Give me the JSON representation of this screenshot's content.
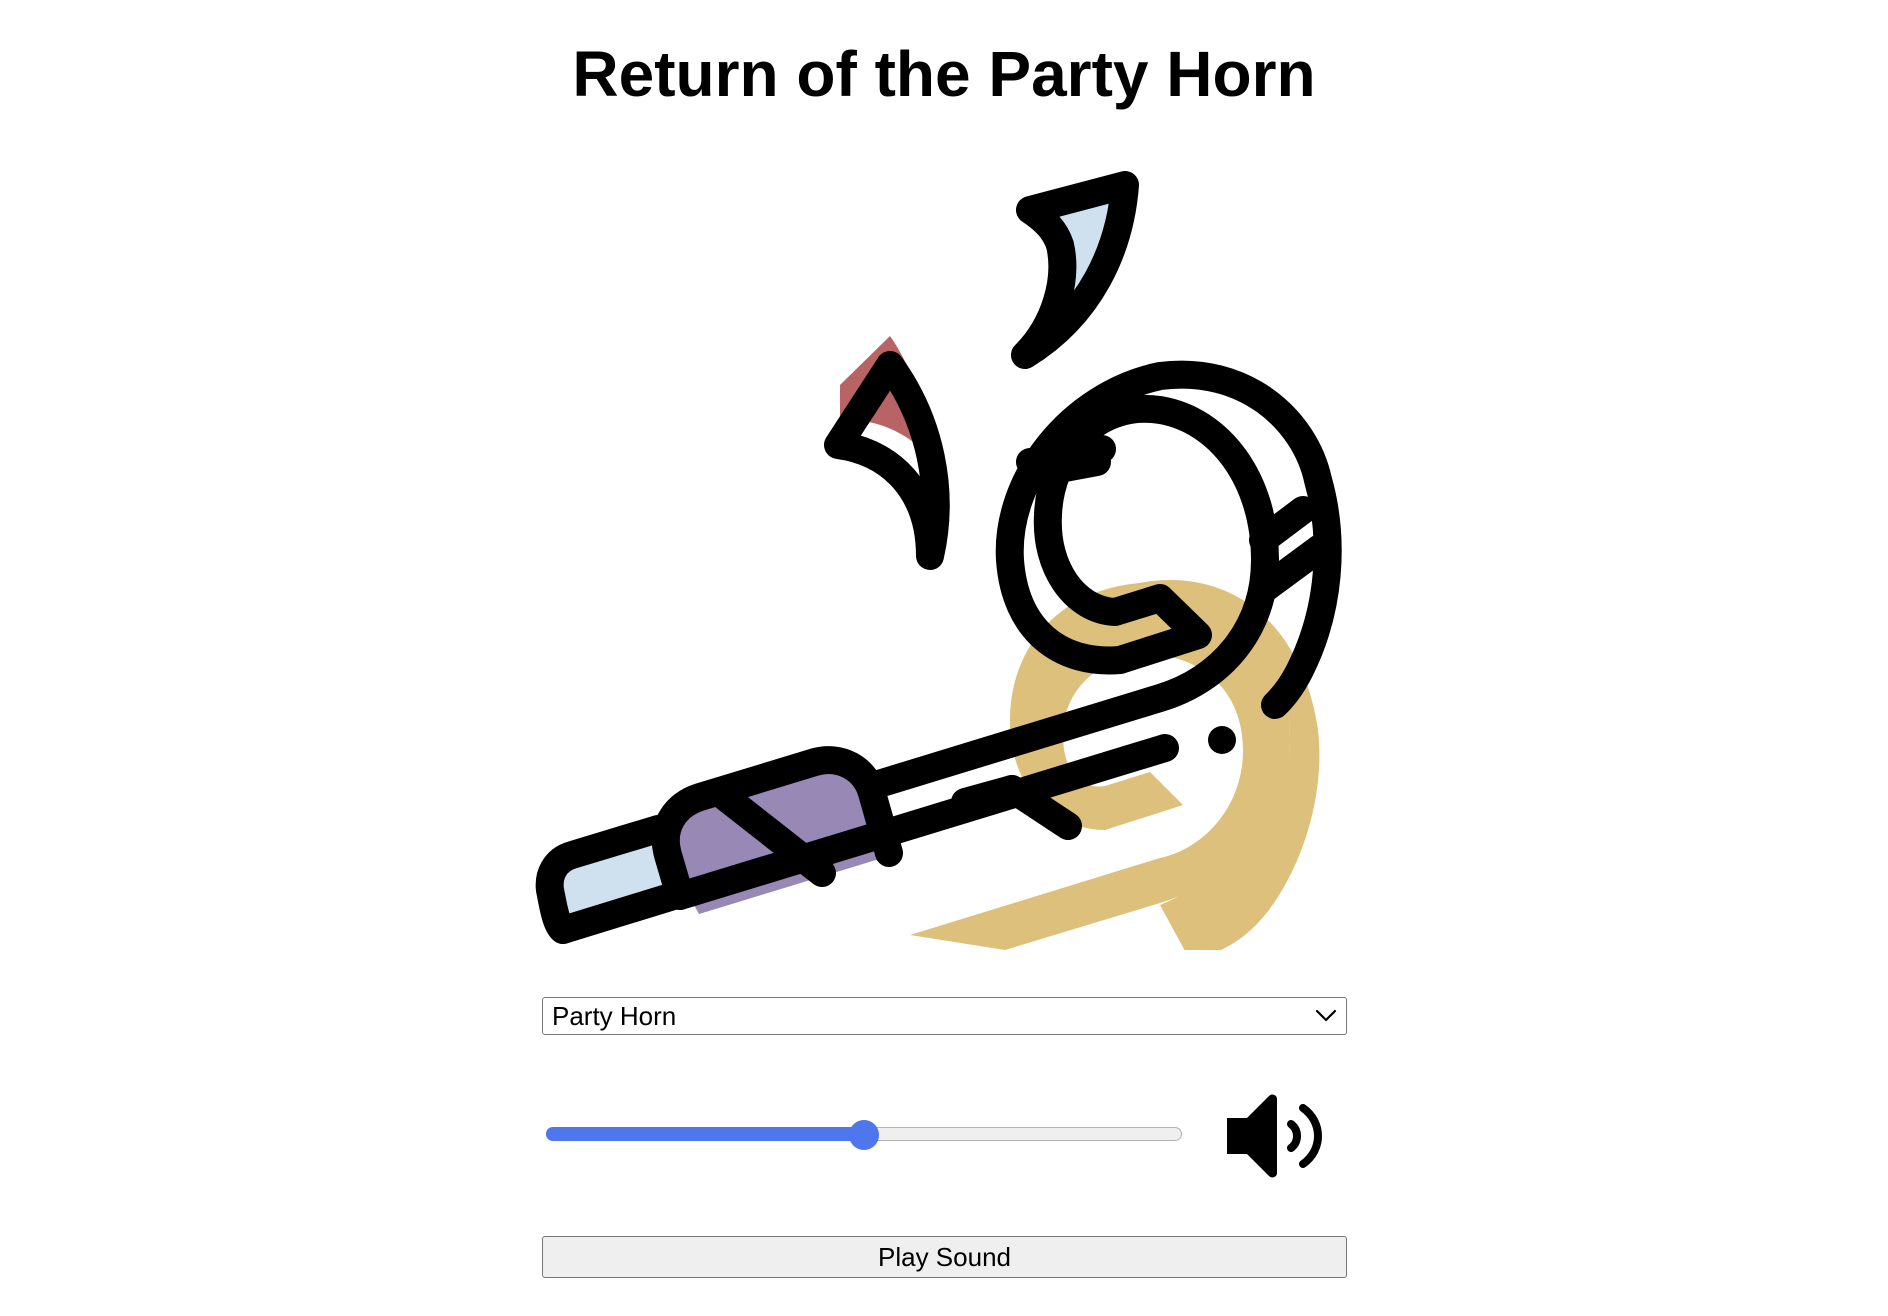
{
  "page": {
    "title": "Return of the Party Horn"
  },
  "horn_image": {
    "icon": "party-horn-icon",
    "colors": {
      "outline": "#000000",
      "horn_tan": "#dcc07c",
      "band_purple": "#9788b5",
      "mouthpiece_blue": "#cfe0ee",
      "confetti_red": "#b86464",
      "confetti_blue": "#cfe0ee"
    }
  },
  "sound_select": {
    "selected": "Party Horn",
    "icon": "chevron-down-icon"
  },
  "volume": {
    "value": 50,
    "min": 0,
    "max": 100,
    "fill_color": "#4e77ee",
    "icon": "volume-high-icon"
  },
  "play_button": {
    "label": "Play Sound"
  }
}
